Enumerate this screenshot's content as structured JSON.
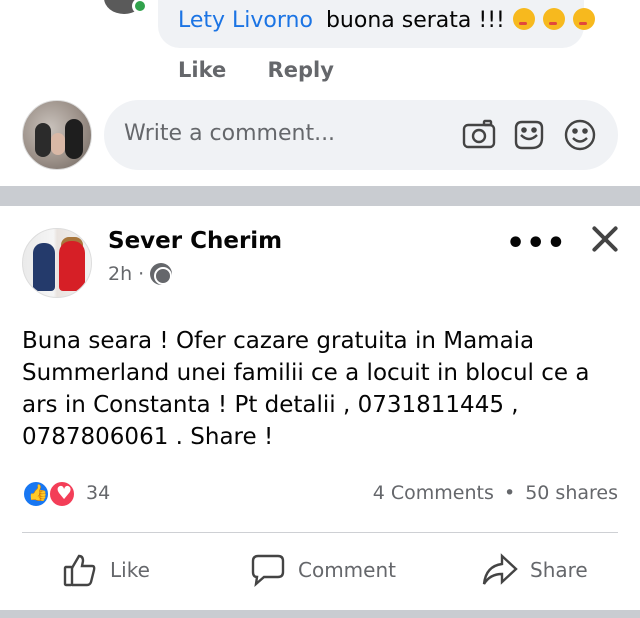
{
  "top_comment": {
    "author": "Lety Livorno",
    "text": "buona serata !!!",
    "emojis": [
      "kiss-face",
      "hug-face",
      "kiss-face"
    ],
    "actions": {
      "like": "Like",
      "reply": "Reply"
    }
  },
  "comment_composer": {
    "placeholder": "Write a comment...",
    "icons": [
      "camera-icon",
      "sticker-icon",
      "emoji-icon"
    ]
  },
  "post": {
    "author": "Sever Cherim",
    "time": "2h",
    "meta_separator": "·",
    "privacy_icon": "globe-icon",
    "text": "Buna seara ! Ofer cazare gratuita in Mamaia Summerland unei familii ce a locuit in blocul ce a ars in Constanta ! Pt detalii , 0731811445  ,  0787806061  . Share !",
    "reactions": {
      "types": [
        "like",
        "love"
      ],
      "count": "34",
      "comments": "4 Comments",
      "separator": "•",
      "shares": "50 shares"
    },
    "actions": {
      "like": "Like",
      "comment": "Comment",
      "share": "Share"
    }
  },
  "colors": {
    "link": "#1b74e4",
    "muted": "#65676b",
    "bubble": "#f0f2f5",
    "separator": "#c9ccd1",
    "like_blue": "#1877f2",
    "love_red": "#f33e58"
  }
}
